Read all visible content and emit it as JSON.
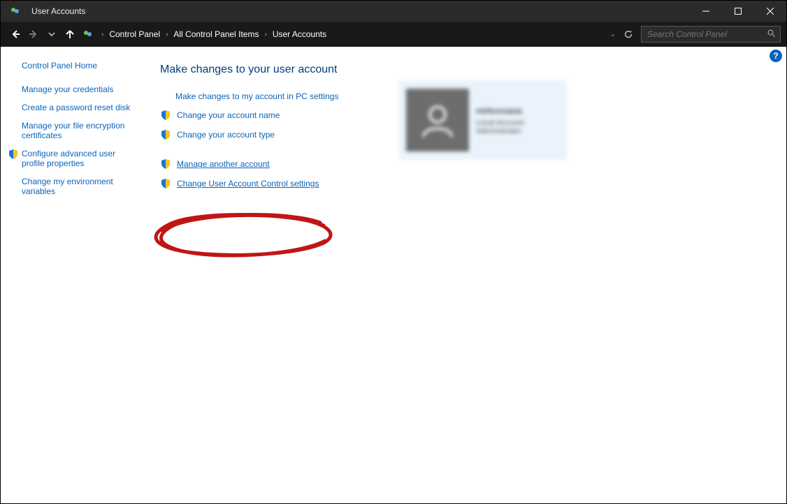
{
  "window": {
    "title": "User Accounts"
  },
  "breadcrumbs": [
    "Control Panel",
    "All Control Panel Items",
    "User Accounts"
  ],
  "search": {
    "placeholder": "Search Control Panel"
  },
  "sidebar": {
    "home": "Control Panel Home",
    "items": [
      {
        "label": "Manage your credentials",
        "shield": false
      },
      {
        "label": "Create a password reset disk",
        "shield": false
      },
      {
        "label": "Manage your file encryption certificates",
        "shield": false
      },
      {
        "label": "Configure advanced user profile properties",
        "shield": true
      },
      {
        "label": "Change my environment variables",
        "shield": false
      }
    ]
  },
  "main": {
    "heading": "Make changes to your user account",
    "group1": [
      {
        "label": "Make changes to my account in PC settings",
        "shield": false,
        "indent": true
      },
      {
        "label": "Change your account name",
        "shield": true
      },
      {
        "label": "Change your account type",
        "shield": true
      }
    ],
    "group2": [
      {
        "label": "Manage another account",
        "shield": true,
        "underlined": true
      },
      {
        "label": "Change User Account Control settings",
        "shield": true,
        "underlined": true
      }
    ]
  },
  "user": {
    "name": "mirkovsasa",
    "type": "Local Account",
    "role": "Administrator"
  }
}
